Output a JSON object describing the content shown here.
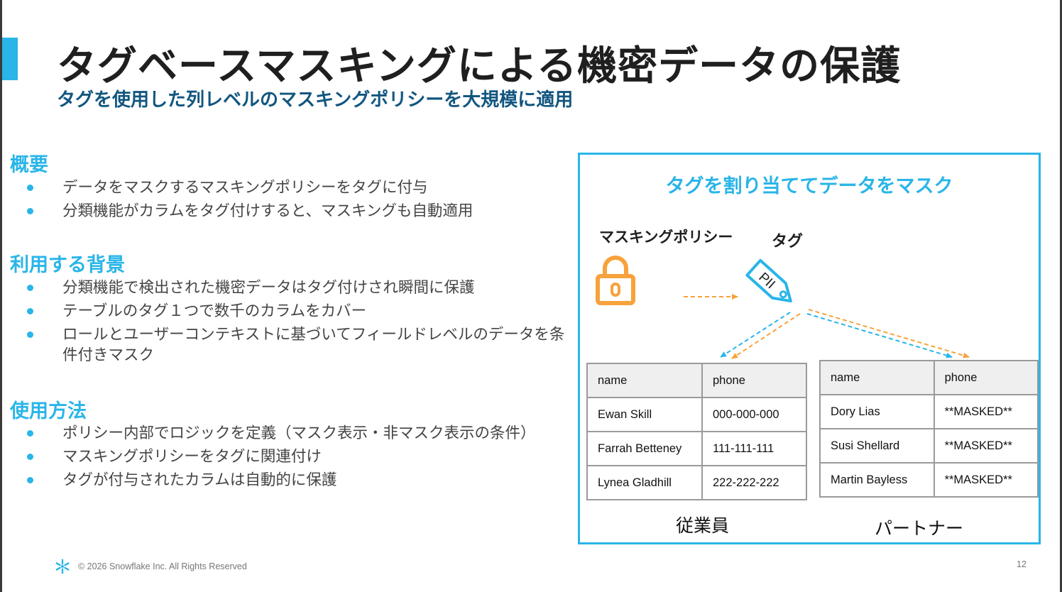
{
  "slide": {
    "title": "タグベースマスキングによる機密データの保護",
    "subtitle": "タグを使用した列レベルのマスキングポリシーを大規模に適用",
    "accent_color": "#29b5e8",
    "subtitle_color": "#11567f"
  },
  "sections": [
    {
      "heading": "概要",
      "bullets": [
        "データをマスクするマスキングポリシーをタグに付与",
        "分類機能がカラムをタグ付けすると、マスキングも自動適用"
      ]
    },
    {
      "heading": "利用する背景",
      "bullets": [
        "分類機能で検出された機密データはタグ付けされ瞬間に保護",
        "テーブルのタグ１つで数千のカラムをカバー",
        "ロールとユーザーコンテキストに基づいてフィールドレベルのデータを条件付きマスク"
      ]
    },
    {
      "heading": "使用方法",
      "bullets": [
        "ポリシー内部でロジックを定義（マスク表示・非マスク表示の条件）",
        "マスキングポリシーをタグに関連付け",
        "タグが付与されたカラムは自動的に保護"
      ]
    }
  ],
  "diagram": {
    "title": "タグを割り当ててデータをマスク",
    "policy_label": "マスキングポリシー",
    "tag_label": "タグ",
    "tag_text": "PII",
    "policy_icon": "lock-icon",
    "arrow_colors": {
      "policy": "#f7a23b",
      "tag": "#29b5e8"
    },
    "employees": {
      "caption": "従業員",
      "header": [
        "name",
        "phone"
      ],
      "rows": [
        [
          "Ewan Skill",
          "000-000-000"
        ],
        [
          "Farrah Betteney",
          "111-111-111"
        ],
        [
          "Lynea Gladhill",
          "222-222-222"
        ]
      ]
    },
    "partners": {
      "caption": "パートナー",
      "header": [
        "name",
        "phone"
      ],
      "rows": [
        [
          "Dory Lias",
          "**MASKED**"
        ],
        [
          "Susi Shellard",
          "**MASKED**"
        ],
        [
          "Martin Bayless",
          "**MASKED**"
        ]
      ]
    }
  },
  "footer": {
    "copyright": "© 2026 Snowflake Inc. All Rights Reserved",
    "page_number": "12",
    "logo_icon": "snowflake-icon"
  }
}
